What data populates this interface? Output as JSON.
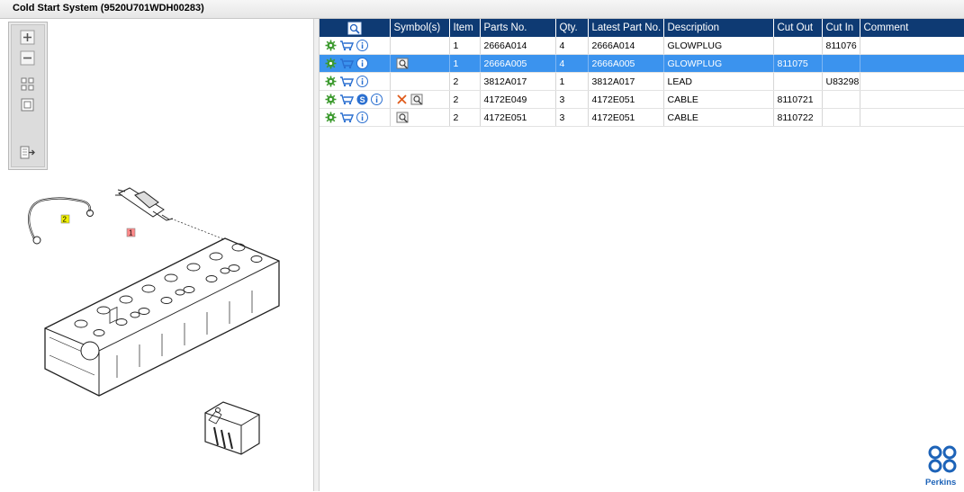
{
  "window": {
    "title": "Cold Start System (9520U701WDH00283)"
  },
  "toolbar": {
    "buttons": [
      "zoom-in",
      "zoom-out",
      "fit-all",
      "fit-window",
      "export-list"
    ]
  },
  "drawing": {
    "callouts": [
      "2",
      "1"
    ]
  },
  "table": {
    "headers": [
      "",
      "Symbol(s)",
      "Item",
      "Parts No.",
      "Qty.",
      "Latest Part No.",
      "Description",
      "Cut Out",
      "Cut In",
      "Comment"
    ],
    "rows": [
      {
        "selected": false,
        "has_s": false,
        "symbols": "",
        "item": "1",
        "part_no": "2666A014",
        "qty": "4",
        "latest": "2666A014",
        "description": "GLOWPLUG",
        "cut_out": "",
        "cut_in": "811076",
        "comment": ""
      },
      {
        "selected": true,
        "has_s": false,
        "symbols": "view",
        "item": "1",
        "part_no": "2666A005",
        "qty": "4",
        "latest": "2666A005",
        "description": "GLOWPLUG",
        "cut_out": "811075",
        "cut_in": "",
        "comment": ""
      },
      {
        "selected": false,
        "has_s": false,
        "symbols": "",
        "item": "2",
        "part_no": "3812A017",
        "qty": "1",
        "latest": "3812A017",
        "description": "LEAD",
        "cut_out": "",
        "cut_in": "U83298",
        "comment": ""
      },
      {
        "selected": false,
        "has_s": true,
        "symbols": "x-view",
        "item": "2",
        "part_no": "4172E049",
        "qty": "3",
        "latest": "4172E051",
        "description": "CABLE",
        "cut_out": "8110721",
        "cut_in": "",
        "comment": ""
      },
      {
        "selected": false,
        "has_s": false,
        "symbols": "view",
        "item": "2",
        "part_no": "4172E051",
        "qty": "3",
        "latest": "4172E051",
        "description": "CABLE",
        "cut_out": "8110722",
        "cut_in": "",
        "comment": ""
      }
    ]
  },
  "logo": {
    "text": "Perkins"
  },
  "colors": {
    "header_bg": "#0e3a73",
    "selected_row": "#3b93ee",
    "icon_green": "#3c9a2e",
    "icon_blue": "#2a6fd0",
    "x_orange": "#e05a1a"
  }
}
